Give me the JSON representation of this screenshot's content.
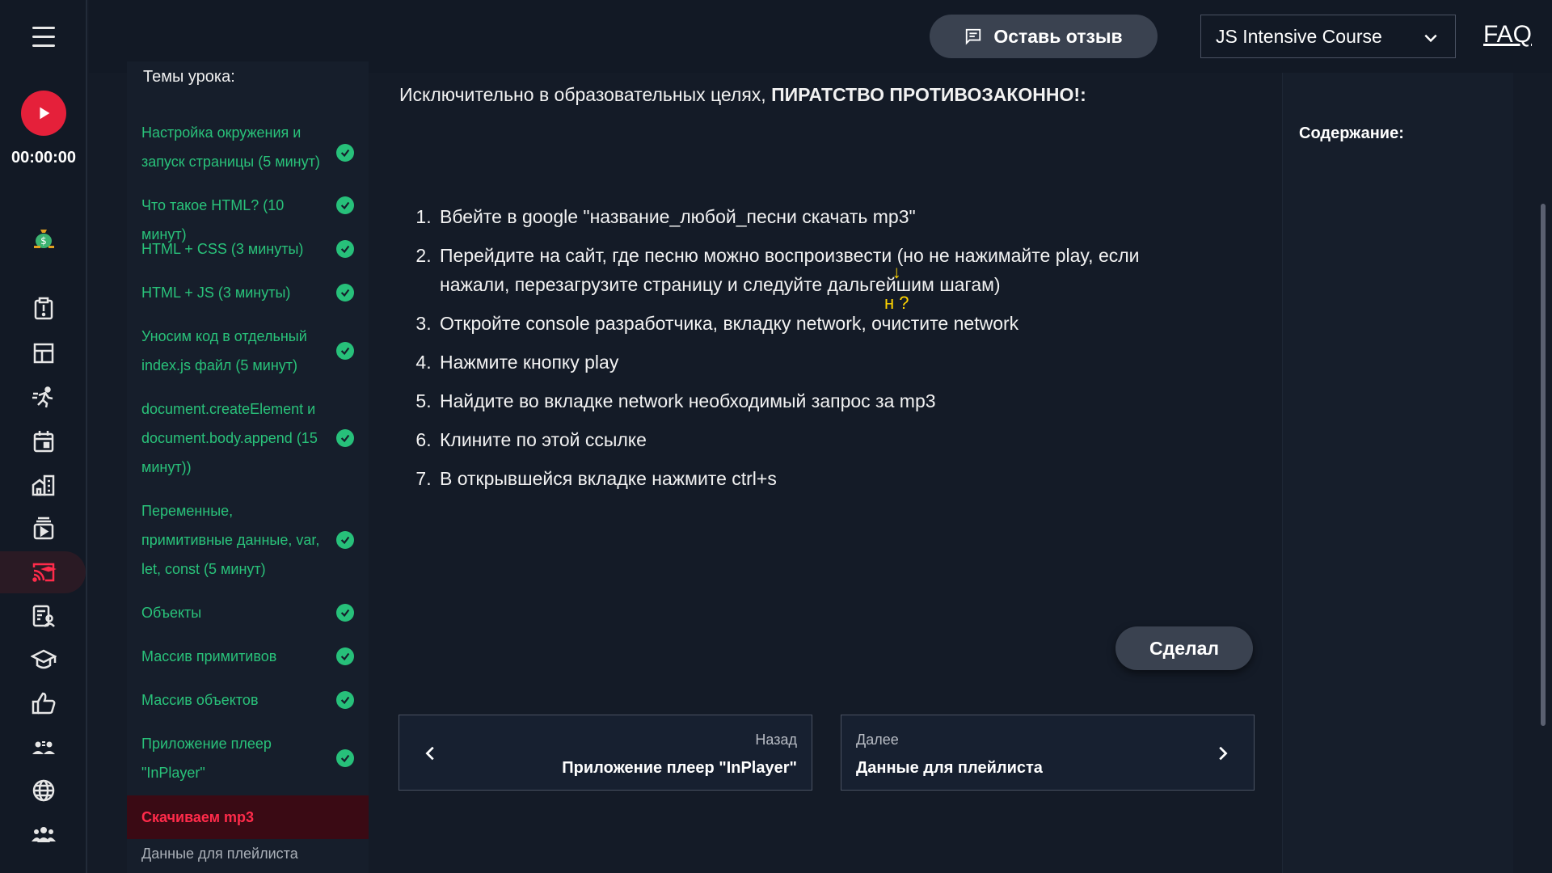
{
  "rail": {
    "timer": "00:00:00",
    "icons": [
      "money-bag-icon",
      "clipboard-alert-icon",
      "dashboard-icon",
      "runner-icon",
      "calendar-icon",
      "city-icon",
      "video-library-icon",
      "cast-education-icon",
      "report-person-icon",
      "school-cap-icon",
      "thumb-up-icon",
      "group-talk-icon",
      "globe-icon",
      "people-icon"
    ]
  },
  "topbar": {
    "feedback_label": "Оставь отзыв",
    "course_selected": "JS Intensive Course",
    "faq_label": "FAQ"
  },
  "lessons": {
    "title": "Темы урока:",
    "items": [
      {
        "label": "Настройка окружения и запуск страницы (5 минут)",
        "done": true
      },
      {
        "label": "Что такое HTML? (10 минут)",
        "done": true
      },
      {
        "label": "HTML + CSS (3 минуты)",
        "done": true
      },
      {
        "label": "HTML + JS (3 минуты)",
        "done": true
      },
      {
        "label": "Уносим код в отдельный index.js файл (5 минут)",
        "done": true
      },
      {
        "label": "document.createElement и document.body.append (15 минут))",
        "done": true
      },
      {
        "label": "Переменные, примитивные данные, var, let, const (5 минут)",
        "done": true
      },
      {
        "label": "Объекты",
        "done": true
      },
      {
        "label": "Массив примитивов",
        "done": true
      },
      {
        "label": "Массив объектов",
        "done": true
      },
      {
        "label": "Приложение плеер \"InPlayer\"",
        "done": true
      },
      {
        "label": "Скачиваем mp3",
        "done": false
      },
      {
        "label": "Данные для плейлиста",
        "done": false
      }
    ]
  },
  "main": {
    "disclaimer_prefix": "Исключительно в образовательных целях, ",
    "disclaimer_bold": "ПИРАТСТВО ПРОТИВОЗАКОННО!:",
    "steps": [
      "Вбейте в google \"название_любой_песни скачать mp3\"",
      "Перейдите на сайт, где песню можно воспроизвести (но не нажимайте play, если нажали, перезагрузите страницу и следуйте дальгейшим шагам)",
      "Откройте console разработчика, вкладку network, очистите network",
      "Нажмите кнопку play",
      "Найдите во вкладке network необходимый запрос за mp3",
      "Клините по этой ссылке",
      "В открывшейся вкладке нажмите ctrl+s"
    ],
    "annotation_arrow": "↓",
    "annotation_text": "н ?",
    "done_label": "Сделал",
    "prev_small": "Назад",
    "prev_title": "Приложение плеер \"InPlayer\"",
    "next_small": "Далее",
    "next_title": "Данные для плейлиста"
  },
  "toc": {
    "title": "Содержание:"
  },
  "colors": {
    "accent_red": "#e5203a",
    "done_green": "#27c07a",
    "active_bg": "#3a0a14"
  }
}
